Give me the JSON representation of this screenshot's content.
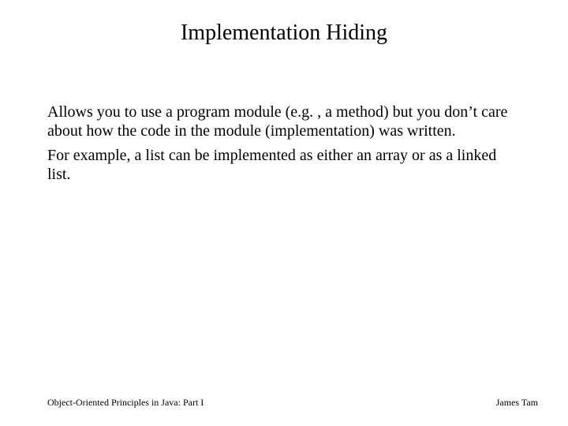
{
  "slide": {
    "title": "Implementation Hiding",
    "paragraphs": [
      "Allows you to use a program module (e.g. , a method) but you don’t care about how the code in the module (implementation) was written.",
      "For example, a list can be implemented as either an array or as a linked list."
    ],
    "footer_left": "Object-Oriented Principles in Java: Part I",
    "footer_right": "James Tam"
  }
}
